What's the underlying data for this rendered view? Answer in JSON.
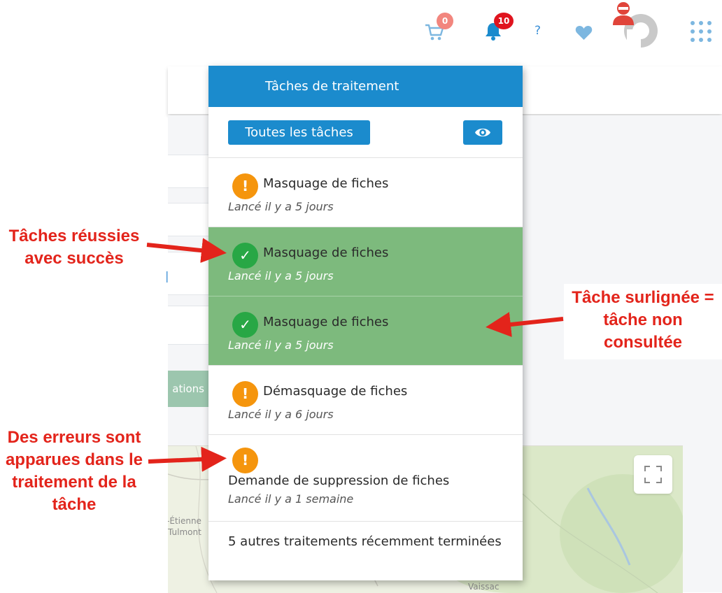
{
  "topbar": {
    "cart": {
      "icon": "cart-icon",
      "count": "0",
      "badge_color": "#f2867e"
    },
    "notifications": {
      "icon": "bell-icon",
      "count": "10",
      "badge_color": "#e0141e"
    },
    "help_label": "?",
    "favorites_icon": "heart-icon",
    "user_icon": "user-avatar-icon",
    "apps_icon": "grid-icon"
  },
  "background": {
    "tab_fragment": "ations",
    "map_labels": [
      "-Étienne",
      "Tulmont",
      "Vaissac"
    ],
    "fullscreen_icon": "fullscreen-icon"
  },
  "panel": {
    "title": "Tâches de traitement",
    "all_tasks_label": "Toutes les tâches",
    "view_icon": "eye-icon",
    "tasks": [
      {
        "status": "warning",
        "glyph": "!",
        "name": "Masquage de fiches",
        "time": "Lancé il y a 5 jours",
        "highlighted": false
      },
      {
        "status": "success",
        "glyph": "✓",
        "name": "Masquage de fiches",
        "time": "Lancé il y a 5 jours",
        "highlighted": true
      },
      {
        "status": "success",
        "glyph": "✓",
        "name": "Masquage de fiches",
        "time": "Lancé il y a 5 jours",
        "highlighted": true
      },
      {
        "status": "warning",
        "glyph": "!",
        "name": "Démasquage de fiches",
        "time": "Lancé il y a 6 jours",
        "highlighted": false
      },
      {
        "status": "warning",
        "glyph": "!",
        "name": "Demande de suppression de fiches",
        "time": "Lancé il y a 1 semaine",
        "highlighted": false
      }
    ],
    "more_label": "5 autres traitements récemment terminées"
  },
  "annotations": {
    "success": [
      "Tâches réussies",
      "avec succès"
    ],
    "highlighted": [
      "Tâche surlignée =",
      "tâche non",
      "consultée"
    ],
    "errors": [
      "Des erreurs sont",
      "apparues dans le",
      "traitement de la",
      "tâche"
    ],
    "color": "#e3241b"
  },
  "colors": {
    "primary": "#1b8bcd",
    "warning": "#f5950d",
    "success": "#28a745",
    "highlight": "#7dba7d"
  }
}
